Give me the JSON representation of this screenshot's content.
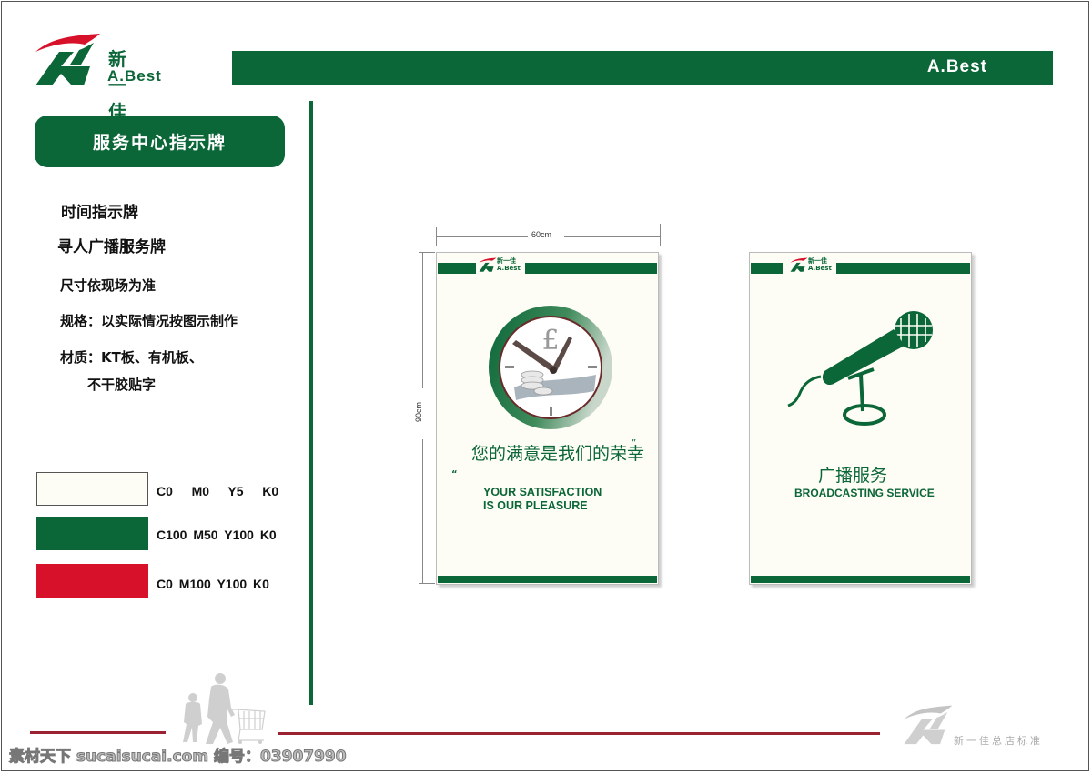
{
  "brand": {
    "name_cn": "新一佳",
    "name_en": "A.Best",
    "header_bar_text": "A.Best",
    "colors": {
      "green": "#0b6638",
      "red": "#d8112b",
      "cream": "#fdfdf5",
      "gray": "#bbbbbb"
    }
  },
  "sidebar": {
    "title": "服务中心指示牌",
    "items": [
      "时间指示牌",
      "寻人广播服务牌"
    ],
    "notes": [
      "尺寸依现场为准",
      "规格：以实际情况按图示制作",
      "材质：KT板、有机板、",
      "不干胶贴字"
    ],
    "swatches": [
      {
        "label": "C0   M0   Y5   K0",
        "color": "#fdfdf5"
      },
      {
        "label": "C100 M50 Y100 K0",
        "color": "#0b6638"
      },
      {
        "label": "C0 M100 Y100 K0",
        "color": "#d8112b"
      }
    ]
  },
  "dimensions": {
    "width": "60cm",
    "height": "90cm"
  },
  "signs": [
    {
      "icon": "clock-pound-icon",
      "cn": "您的满意是我们的荣幸",
      "open_quote": "“",
      "close_quote": "”",
      "en_line1": "YOUR SATISFACTION",
      "en_line2": "IS OUR PLEASURE"
    },
    {
      "icon": "microphone-icon",
      "cn": "广播服务",
      "en_line1": "BROADCASTING SERVICE"
    }
  ],
  "mini_logo": {
    "cn": "新一佳",
    "en": "A.Best"
  },
  "footer": {
    "standard_text": "新一佳总店标准",
    "watermark": "素材天下 sucaisucai.com  编号：03907990"
  }
}
